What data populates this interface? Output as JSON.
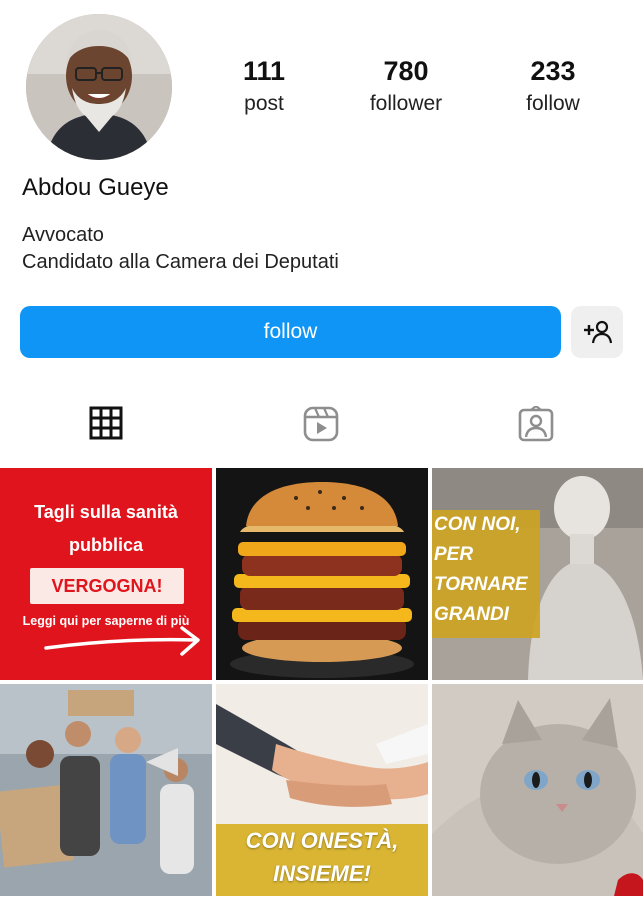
{
  "profile": {
    "name": "Abdou Gueye",
    "bio_line1": "Avvocato",
    "bio_line2": "Candidato alla Camera dei Deputati"
  },
  "stats": [
    {
      "value": "111",
      "label": "post"
    },
    {
      "value": "780",
      "label": "follower"
    },
    {
      "value": "233",
      "label": "follow"
    }
  ],
  "actions": {
    "follow_label": "follow",
    "suggest_icon": "add-person-icon"
  },
  "tabs": [
    {
      "icon": "grid-icon",
      "selected": true
    },
    {
      "icon": "reels-icon",
      "selected": false
    },
    {
      "icon": "tagged-icon",
      "selected": false
    }
  ],
  "posts": {
    "p1": {
      "line1": "Tagli sulla sanità",
      "line2": "pubblica",
      "box": "VERGOGNA!",
      "line3": "Leggi qui per saperne di più"
    },
    "p3": {
      "lines": [
        "CON NOI,",
        "PER",
        "TORNARE",
        "GRANDI"
      ]
    },
    "p5": {
      "line1": "CON ONESTÀ,",
      "line2": "INSIEME!"
    }
  },
  "colors": {
    "accent": "#0f95f5",
    "post_red": "#e0141c",
    "gold": "#cda323"
  }
}
